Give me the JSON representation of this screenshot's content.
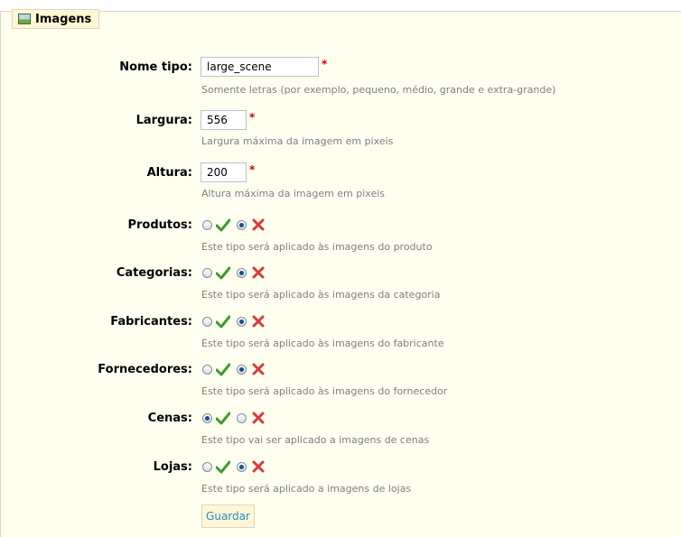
{
  "section_title": "Imagens",
  "fields": {
    "nome": {
      "label": "Nome tipo:",
      "value": "large_scene",
      "required": "*",
      "hint": "Somente letras (por exemplo, pequeno, médio, grande e extra-grande)"
    },
    "largura": {
      "label": "Largura:",
      "value": "556",
      "required": "*",
      "hint": "Largura máxima da imagem em pixeis"
    },
    "altura": {
      "label": "Altura:",
      "value": "200",
      "required": "*",
      "hint": "Altura máxima da imagem em pixeis"
    }
  },
  "toggles": [
    {
      "key": "produtos",
      "label": "Produtos:",
      "selected": "no",
      "hint": "Este tipo será aplicado às imagens do produto"
    },
    {
      "key": "categorias",
      "label": "Categorias:",
      "selected": "no",
      "hint": "Este tipo será aplicado às imagens da categoria"
    },
    {
      "key": "fabricantes",
      "label": "Fabricantes:",
      "selected": "no",
      "hint": "Este tipo será aplicado às imagens do fabricante"
    },
    {
      "key": "fornecedores",
      "label": "Fornecedores:",
      "selected": "no",
      "hint": "Este tipo será aplicado às imagens do fornecedor"
    },
    {
      "key": "cenas",
      "label": "Cenas:",
      "selected": "yes",
      "hint": "Este tipo vai ser aplicado a imagens de cenas"
    },
    {
      "key": "lojas",
      "label": "Lojas:",
      "selected": "no",
      "hint": "Este tipo será aplicado a imagens de lojas"
    }
  ],
  "submit_label": "Guardar",
  "icons": {
    "legend": "image-icon",
    "yes": "check-icon",
    "no": "cross-icon"
  },
  "colors": {
    "background": "#fffff0",
    "legend_bg": "#fff6d3",
    "border": "#dfd5c3",
    "required": "#cc0000",
    "hint": "#7f7f7f",
    "button_text": "#268ccd",
    "check": "#3d9b2d",
    "cross": "#d83a3a"
  }
}
